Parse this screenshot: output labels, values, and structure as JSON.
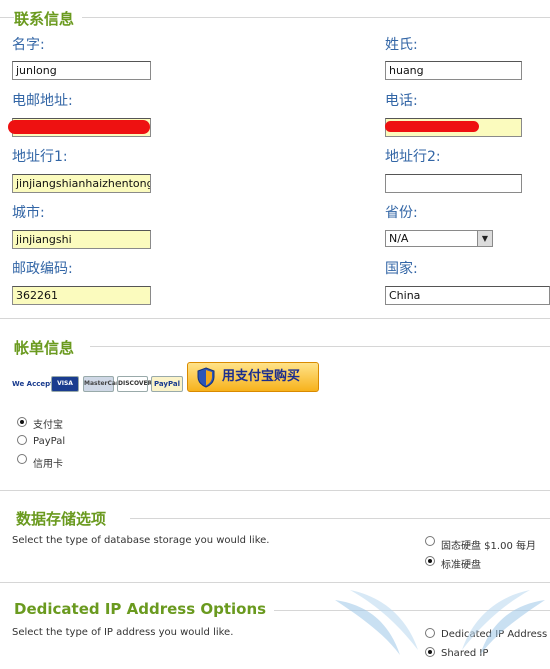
{
  "contact": {
    "title": "联系信息",
    "name_label": "名字:",
    "name_value": "junlong",
    "surname_label": "姓氏:",
    "surname_value": "huang",
    "email_label": "电邮地址:",
    "phone_label": "电话:",
    "address1_label": "地址行1:",
    "address1_value": "jinjiangshianhaizhentonglin",
    "address2_label": "地址行2:",
    "address2_value": "",
    "city_label": "城市:",
    "city_value": "jinjiangshi",
    "province_label": "省份:",
    "province_value": "N/A",
    "postal_label": "邮政编码:",
    "postal_value": "362261",
    "country_label": "国家:",
    "country_value": "China"
  },
  "billing": {
    "title": "帐单信息",
    "we_accept": "We Accept",
    "cards": [
      "VISA",
      "MasterCard",
      "DISCOVER",
      "PayPal"
    ],
    "alipay_button": "用支付宝购买",
    "methods": [
      {
        "label": "支付宝",
        "checked": true
      },
      {
        "label": "PayPal",
        "checked": false
      },
      {
        "label": "信用卡",
        "checked": false
      }
    ]
  },
  "storage": {
    "title": "数据存储选项",
    "description": "Select the type of database storage you would like.",
    "options": [
      {
        "label": "固态硬盘 $1.00 每月",
        "checked": false
      },
      {
        "label": "标准硬盘",
        "checked": true
      }
    ]
  },
  "ip": {
    "title": "Dedicated IP Address Options",
    "description": "Select the type of IP address you would like.",
    "options": [
      {
        "label": "Dedicated IP Address",
        "checked": false
      },
      {
        "label": "Shared IP",
        "checked": true
      }
    ]
  },
  "colors": {
    "section_title": "#6a9a1f",
    "label": "#3366a6",
    "highlight_input": "#fbfbbe",
    "redaction": "#ee1111"
  }
}
